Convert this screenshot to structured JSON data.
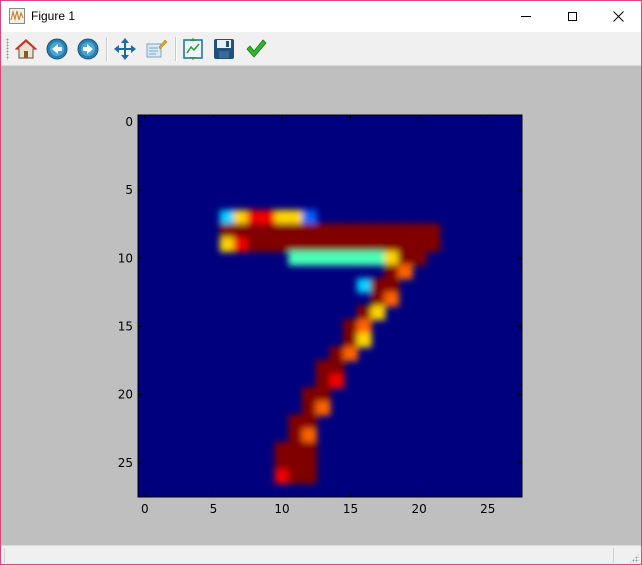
{
  "window": {
    "title": "Figure 1",
    "controls": [
      "minimize",
      "maximize",
      "close"
    ]
  },
  "toolbar": {
    "buttons": [
      {
        "name": "home",
        "icon": "home-icon"
      },
      {
        "name": "back",
        "icon": "back-arrow-icon"
      },
      {
        "name": "forward",
        "icon": "forward-arrow-icon"
      },
      {
        "name": "pan",
        "icon": "move-arrows-icon"
      },
      {
        "name": "zoom",
        "icon": "zoom-rect-icon"
      },
      {
        "name": "subplots",
        "icon": "configure-subplots-icon"
      },
      {
        "name": "save",
        "icon": "floppy-disk-icon"
      },
      {
        "name": "edit",
        "icon": "checkmark-icon"
      }
    ]
  },
  "colors": {
    "background": "#bfbfbf",
    "plot_low": "#00007f",
    "accent_border": "#e0427a"
  },
  "chart_data": {
    "type": "heatmap",
    "colormap": "jet",
    "xlim": [
      -0.5,
      27.5
    ],
    "ylim": [
      27.5,
      -0.5
    ],
    "x_ticks": [
      0,
      5,
      10,
      15,
      20,
      25
    ],
    "y_ticks": [
      0,
      5,
      10,
      15,
      20,
      25
    ],
    "x_tick_labels": [
      "0",
      "5",
      "10",
      "15",
      "20",
      "25"
    ],
    "y_tick_labels": [
      "0",
      "5",
      "10",
      "15",
      "20",
      "25"
    ],
    "description_digit": "7",
    "rows": [
      "............................",
      "............................",
      "............................",
      "............................",
      "............................",
      "............................",
      "............................",
      "......3688662...............",
      "......9999999999999999......",
      "......6899999999999999......",
      "...........4444444699.......",
      "..................97........",
      "................399.........",
      ".................97.........",
      "................96..........",
      "...............97...........",
      "...............96...........",
      "..............97............",
      ".............99.............",
      ".............98.............",
      "............99..............",
      "............97..............",
      "...........99...............",
      "...........97...............",
      "..........999...............",
      "..........999...............",
      "..........899...............",
      "............................"
    ]
  }
}
